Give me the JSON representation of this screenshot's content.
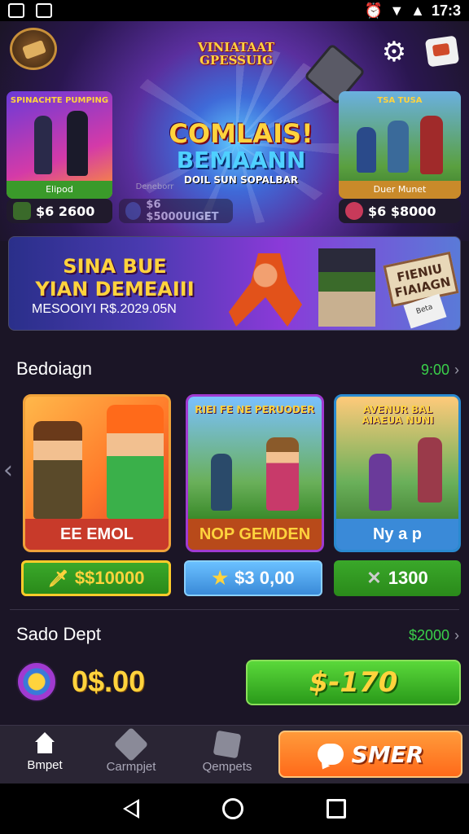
{
  "status_bar": {
    "time": "17:3"
  },
  "hero": {
    "top_title": "VINIATAAT GPESSUIG",
    "center_title_1": "COMLAIS!",
    "center_title_2": "BEMAANN",
    "center_title_3": "DOIL SUN SOPALBAR",
    "left_card": {
      "title": "SPINACHTE PUMPING",
      "label": "Elipod",
      "price": "$6 2600"
    },
    "mid_card": {
      "label": "Deneborr",
      "price": "$6 $5000UIGET"
    },
    "right_card": {
      "title": "TSA TUSA",
      "label": "Duer Munet",
      "price": "$6 $8000"
    }
  },
  "banner": {
    "title_line1": "SINA BUE",
    "title_line2": "YIAN DEMEAIII",
    "subtitle": "MESOOIYI R$.2029.05N",
    "sign": "FIENIU FIAIAGN",
    "paper": "Beta"
  },
  "section1": {
    "title": "Bedoiagn",
    "more": "9:00",
    "games": [
      {
        "name": "EE EMOL",
        "title": "",
        "price": "$$10000"
      },
      {
        "name": "NOP GEMDEN",
        "title": "RIEI FE NE PERUODER",
        "price": "$3 0,00"
      },
      {
        "name": "Ny a p",
        "title": "AVENUR BAL AIAEUA NUNI",
        "price": "1300"
      }
    ]
  },
  "section2": {
    "title": "Sado Dept",
    "more": "$2000",
    "balance": "0$.00",
    "buy_label": "$-170"
  },
  "bottom_nav": {
    "items": [
      "Bmpet",
      "Carmpjet",
      "Qempets"
    ],
    "action_label": "SMER"
  },
  "colors": {
    "accent_green": "#3ad04a",
    "gold": "#ffd33d",
    "orange": "#ff7a2a"
  }
}
